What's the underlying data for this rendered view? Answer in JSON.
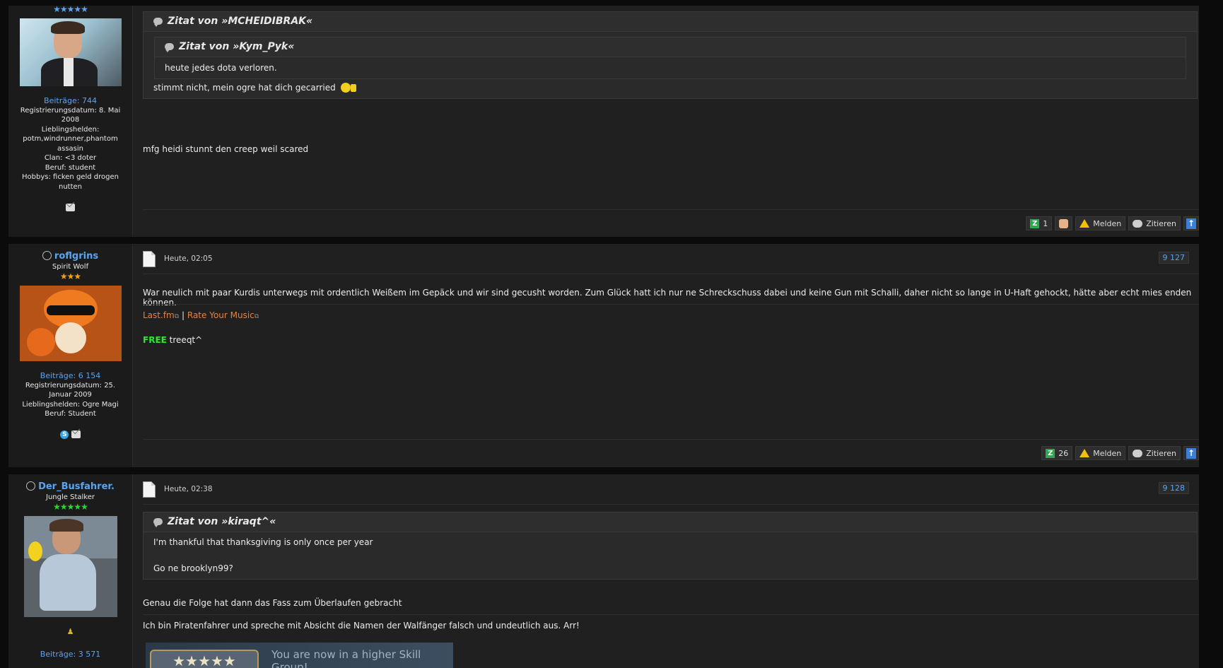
{
  "post1": {
    "user": {
      "stars": "★★★★★",
      "posts": "Beiträge: 744",
      "reg": "Registrierungsdatum: 8. Mai 2008",
      "heroes_label": "Lieblingshelden:",
      "heroes": "potm,windrunner,phantom assasin",
      "clan": "Clan: <3 doter",
      "job": "Beruf: student",
      "hobbys": "Hobbys: ficken geld drogen nutten"
    },
    "quote_outer_author": "Zitat von »MCHEIDIBRAK«",
    "quote_inner_author": "Zitat von »Kym_Pyk«",
    "quote_inner_text": "heute jedes dota verloren.",
    "quote_outer_text": "stimmt nicht, mein ogre hat dich gecarried",
    "body": "mfg heidi stunnt den creep weil scared",
    "actions": {
      "like_count": "1",
      "report": "Melden",
      "quote": "Zitieren"
    }
  },
  "post2": {
    "user": {
      "name": "roflgrins",
      "rank": "Spirit Wolf",
      "stars": "★★★",
      "posts": "Beiträge: 6 154",
      "reg": "Registrierungsdatum: 25. Januar 2009",
      "heroes": "Lieblingshelden: Ogre Magi",
      "job": "Beruf: Student"
    },
    "date": "Heute, 02:05",
    "number": "9 127",
    "body": "War neulich mit paar Kurdis unterwegs mit ordentlich Weißem im Gepäck und wir sind gecusht worden. Zum Glück hatt ich nur ne Schreckschuss dabei und keine Gun mit Schalli, daher nicht so lange in U-Haft gehockt, hätte aber echt mies enden können.",
    "sig_link1": "Last.fm",
    "sig_sep": "|",
    "sig_link2": "Rate Your Music",
    "free_label": "FREE",
    "free_text": "treeqt^",
    "actions": {
      "like_count": "26",
      "report": "Melden",
      "quote": "Zitieren"
    }
  },
  "post3": {
    "user": {
      "name": "Der_Busfahrer.",
      "rank": "Jungle Stalker",
      "stars": "★★★★★",
      "posts": "Beiträge: 3 571"
    },
    "date": "Heute, 02:38",
    "number": "9 128",
    "quote_author": "Zitat von »kiraqt^«",
    "quote_line1": "I'm thankful that thanksgiving is only once per year",
    "quote_line2": "Go ne brooklyn99?",
    "body": "Genau die Folge hat dann das Fass zum Überlaufen gebracht",
    "sig": "Ich bin Piratenfahrer und spreche mit Absicht die Namen der Walfänger falsch und undeutlich aus. Arr!",
    "banner_text": "You are now in a higher Skill Group!"
  },
  "colors": {
    "accent_blue": "#5ba4ef",
    "link_orange": "#f08030",
    "free_green": "#2ee82e"
  }
}
